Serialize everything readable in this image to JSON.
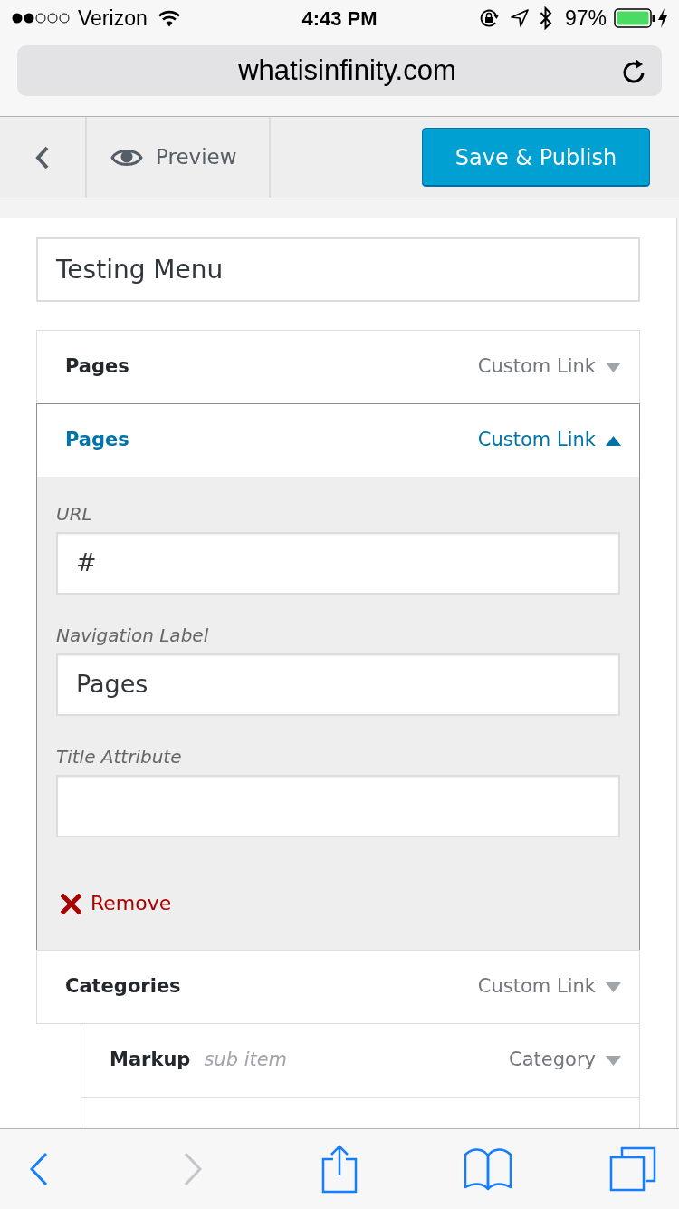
{
  "status_bar": {
    "carrier": "Verizon",
    "time": "4:43 PM",
    "battery": "97%"
  },
  "address_bar": {
    "url": "whatisinfinity.com"
  },
  "customizer_header": {
    "preview": "Preview",
    "publish_button": "Save & Publish"
  },
  "menu_name": {
    "value": "Testing Menu"
  },
  "menu_items": [
    {
      "title": "Pages",
      "type": "Custom Link",
      "expanded": false
    },
    {
      "title": "Pages",
      "type": "Custom Link",
      "expanded": true,
      "fields": [
        {
          "label": "URL",
          "value": "#"
        },
        {
          "label": "Navigation Label",
          "value": "Pages"
        },
        {
          "label": "Title Attribute"
        }
      ],
      "remove": "Remove"
    },
    {
      "title": "Categories",
      "type": "Custom Link",
      "expanded": false,
      "children": [
        {
          "title": "Markup",
          "note": "sub item",
          "type": "Category",
          "expanded": false
        }
      ]
    }
  ],
  "toolbar": {
    "buttons": [
      {
        "kind": "back",
        "disabled": false
      },
      {
        "kind": "forward",
        "disabled": true
      },
      {
        "kind": "share",
        "disabled": false
      },
      {
        "kind": "bookmarks",
        "disabled": false
      },
      {
        "kind": "tabs",
        "disabled": false
      }
    ]
  }
}
